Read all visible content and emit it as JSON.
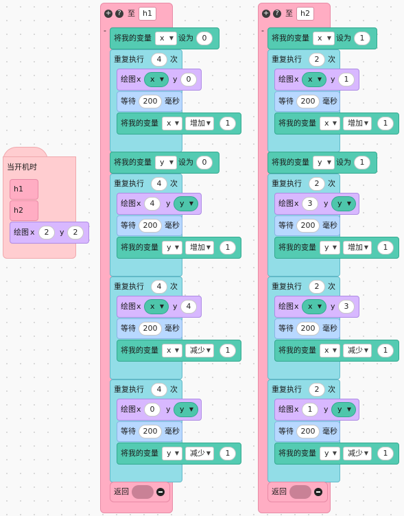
{
  "event": {
    "title": "当开机时",
    "calls": [
      "h1",
      "h2"
    ],
    "draw": {
      "label": "绘图",
      "x_label": "x",
      "x": "2",
      "y_label": "y",
      "y": "2"
    }
  },
  "labels": {
    "set_var": "将我的变量",
    "set_to": "设为",
    "repeat": "重复执行",
    "times": "次",
    "draw": "绘图",
    "x": "x",
    "y": "y",
    "wait": "等待",
    "ms": "毫秒",
    "change_var": "将我的变量",
    "increase": "增加",
    "decrease": "减少",
    "return": "返回",
    "to": "至",
    "collapse": "-"
  },
  "functions": [
    {
      "name": "h1",
      "sections": [
        {
          "set": {
            "var": "x",
            "value": "0"
          },
          "repeat": "4",
          "draw": {
            "x": "x",
            "y": "0",
            "x_var": true
          },
          "wait": "200",
          "change": {
            "var": "x",
            "op": "增加",
            "value": "1"
          }
        },
        {
          "set": {
            "var": "y",
            "value": "0"
          },
          "repeat": "4",
          "draw": {
            "x": "4",
            "y": "y",
            "y_var": true
          },
          "wait": "200",
          "change": {
            "var": "y",
            "op": "增加",
            "value": "1"
          }
        },
        {
          "repeat": "4",
          "draw": {
            "x": "x",
            "y": "4",
            "x_var": true
          },
          "wait": "200",
          "change": {
            "var": "x",
            "op": "减少",
            "value": "1"
          }
        },
        {
          "repeat": "4",
          "draw": {
            "x": "0",
            "y": "y",
            "y_var": true
          },
          "wait": "200",
          "change": {
            "var": "y",
            "op": "减少",
            "value": "1"
          }
        }
      ]
    },
    {
      "name": "h2",
      "sections": [
        {
          "set": {
            "var": "x",
            "value": "1"
          },
          "repeat": "2",
          "draw": {
            "x": "x",
            "y": "1",
            "x_var": true
          },
          "wait": "200",
          "change": {
            "var": "x",
            "op": "增加",
            "value": "1"
          }
        },
        {
          "set": {
            "var": "y",
            "value": "1"
          },
          "repeat": "2",
          "draw": {
            "x": "3",
            "y": "y",
            "y_var": true
          },
          "wait": "200",
          "change": {
            "var": "y",
            "op": "增加",
            "value": "1"
          }
        },
        {
          "repeat": "2",
          "draw": {
            "x": "x",
            "y": "3",
            "x_var": true
          },
          "wait": "200",
          "change": {
            "var": "x",
            "op": "减少",
            "value": "1"
          }
        },
        {
          "repeat": "2",
          "draw": {
            "x": "1",
            "y": "y",
            "y_var": true
          },
          "wait": "200",
          "change": {
            "var": "y",
            "op": "减少",
            "value": "1"
          }
        }
      ]
    }
  ],
  "colors": {
    "function": "#ffadc3",
    "event": "#ffcdd0",
    "variable": "#54cbb2",
    "repeat": "#92dde7",
    "draw": "#d8b8ff",
    "wait": "#b8d8ff"
  },
  "icons": [
    "plus-circle-icon",
    "help-circle-icon",
    "minus-circle-icon",
    "dropdown-arrow-icon"
  ]
}
